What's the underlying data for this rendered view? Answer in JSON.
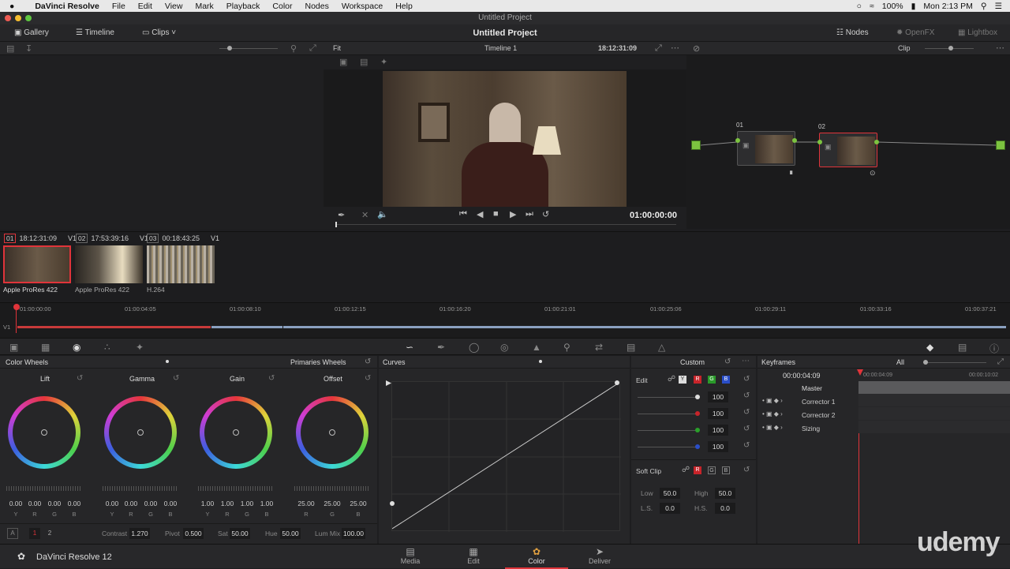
{
  "menubar": {
    "apple": "",
    "app": "DaVinci Resolve",
    "items": [
      "File",
      "Edit",
      "View",
      "Mark",
      "Playback",
      "Color",
      "Nodes",
      "Workspace",
      "Help"
    ],
    "battery": "100%",
    "clock": "Mon 2:13 PM"
  },
  "window": {
    "title": "Untitled Project"
  },
  "toolbar": {
    "gallery": "Gallery",
    "timeline": "Timeline",
    "clips": "Clips",
    "project_title": "Untitled Project",
    "nodes": "Nodes",
    "openfx": "OpenFX",
    "lightbox": "Lightbox"
  },
  "subbar": {
    "fit": "Fit",
    "timeline_name": "Timeline 1",
    "timecode": "18:12:31:09",
    "clip_mode": "Clip"
  },
  "viewer": {
    "timecode": "01:00:00:00"
  },
  "nodes": [
    {
      "label": "01"
    },
    {
      "label": "02"
    }
  ],
  "clips": [
    {
      "num": "01",
      "tc": "18:12:31:09",
      "track": "V1",
      "codec": "Apple ProRes 422"
    },
    {
      "num": "02",
      "tc": "17:53:39:16",
      "track": "V1",
      "codec": "Apple ProRes 422"
    },
    {
      "num": "03",
      "tc": "00:18:43:25",
      "track": "V1",
      "codec": "H.264"
    }
  ],
  "timeline": {
    "track": "V1",
    "ticks": [
      "01:00:00:00",
      "01:00:04:05",
      "01:00:08:10",
      "01:00:12:15",
      "01:00:16:20",
      "01:00:21:01",
      "01:00:25:06",
      "01:00:29:11",
      "01:00:33:16",
      "01:00:37:21"
    ]
  },
  "color_wheels": {
    "title": "Color Wheels",
    "mode": "Primaries Wheels",
    "wheels": [
      {
        "name": "Lift",
        "values": [
          "0.00",
          "0.00",
          "0.00",
          "0.00"
        ]
      },
      {
        "name": "Gamma",
        "values": [
          "0.00",
          "0.00",
          "0.00",
          "0.00"
        ]
      },
      {
        "name": "Gain",
        "values": [
          "1.00",
          "1.00",
          "1.00",
          "1.00"
        ]
      },
      {
        "name": "Offset",
        "values": [
          "25.00",
          "25.00",
          "25.00"
        ]
      }
    ],
    "sub4": [
      "Y",
      "R",
      "G",
      "B"
    ],
    "sub3": [
      "R",
      "G",
      "B"
    ],
    "footer": {
      "a": "A",
      "p1": "1",
      "p2": "2",
      "contrast_label": "Contrast",
      "contrast": "1.270",
      "pivot_label": "Pivot",
      "pivot": "0.500",
      "sat_label": "Sat",
      "sat": "50.00",
      "hue_label": "Hue",
      "hue": "50.00",
      "lummix_label": "Lum Mix",
      "lummix": "100.00"
    }
  },
  "curves": {
    "title": "Curves",
    "mode": "Custom"
  },
  "curve_edit": {
    "edit": "Edit",
    "y": "Y",
    "r": "R",
    "g": "G",
    "b": "B",
    "values": [
      "100",
      "100",
      "100",
      "100"
    ],
    "soft_clip": "Soft Clip",
    "low_label": "Low",
    "low": "50.0",
    "high_label": "High",
    "high": "50.0",
    "ls_label": "L.S.",
    "ls": "0.0",
    "hs_label": "H.S.",
    "hs": "0.0"
  },
  "keyframes": {
    "title": "Keyframes",
    "filter": "All",
    "timecode": "00:00:04:09",
    "t1": "00:00:04:09",
    "t2": "00:00:10:02",
    "rows": [
      "Master",
      "Corrector 1",
      "Corrector 2",
      "Sizing"
    ]
  },
  "bottom": {
    "app": "DaVinci Resolve 12",
    "pages": [
      "Media",
      "Edit",
      "Color",
      "Deliver"
    ]
  },
  "watermark": "udemy",
  "colors": {
    "accent": "#e0343a",
    "node_green": "#7cc340"
  }
}
